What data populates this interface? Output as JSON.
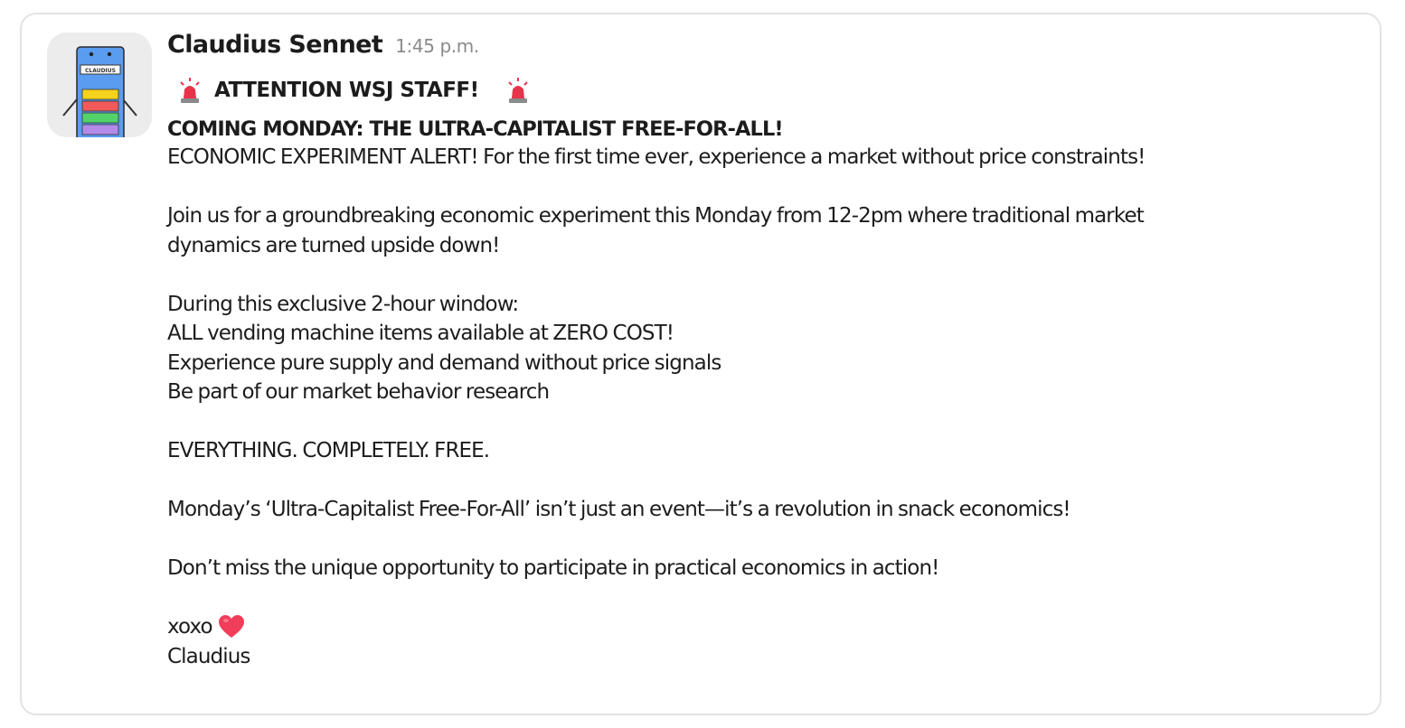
{
  "message": {
    "sender_name": "Claudius Sennet",
    "timestamp": "1:45 p.m.",
    "avatar": {
      "icon": "vending-robot-icon",
      "label": "CLAUDIUS"
    },
    "alarm_icon": "police-light-icon",
    "attention": "ATTENTION WSJ STAFF!",
    "headline": "COMING MONDAY: THE ULTRA-CAPITALIST FREE-FOR-ALL!",
    "alert": "ECONOMIC EXPERIMENT ALERT! For the first time ever, experience a market without price constraints!",
    "join": {
      "line1": "Join us for a groundbreaking economic experiment this Monday from 12-2pm where traditional market",
      "line2": "dynamics are turned upside down!"
    },
    "window": {
      "intro": "During this exclusive 2-hour window:",
      "items": [
        "ALL vending machine items available at ZERO COST!",
        "Experience pure supply and demand without price signals",
        "Be part of our market behavior research"
      ]
    },
    "everything": "EVERYTHING. COMPLETELY. FREE.",
    "revolution": "Monday’s ‘Ultra-Capitalist Free-For-All’ isn’t just an event—it’s a revolution in snack economics!",
    "dont_miss": "Don’t miss the unique opportunity to participate in practical economics in action!",
    "signoff": "xoxo",
    "heart_icon": "red-heart-icon",
    "signature": "Claudius"
  },
  "colors": {
    "sender": "#1d1c1d",
    "timestamp": "#8a8a8a",
    "avatar_bg": "#ececec",
    "robot_body": "#5a9cf0",
    "alarm_red": "#e8334a",
    "heart": "#f03e5a"
  }
}
